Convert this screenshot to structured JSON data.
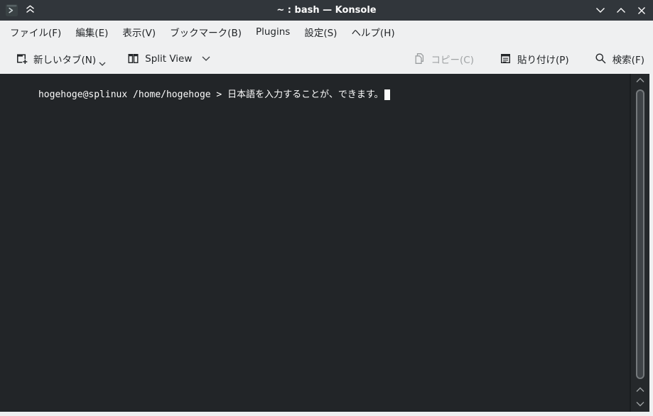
{
  "window": {
    "title": "~ : bash — Konsole"
  },
  "menubar": {
    "items": [
      {
        "label": "ファイル(F)"
      },
      {
        "label": "編集(E)"
      },
      {
        "label": "表示(V)"
      },
      {
        "label": "ブックマーク(B)"
      },
      {
        "label": "Plugins"
      },
      {
        "label": "設定(S)"
      },
      {
        "label": "ヘルプ(H)"
      }
    ]
  },
  "toolbar": {
    "new_tab_label": "新しいタブ(N)",
    "split_view_label": "Split View",
    "copy_label": "コピー(C)",
    "copy_enabled": false,
    "paste_label": "貼り付け(P)",
    "search_label": "検索(F)"
  },
  "terminal": {
    "prompt": "hogehoge@splinux /home/hogehoge > ",
    "typed_text": "日本語を入力することが、できます。",
    "cursor": "block"
  },
  "icons": {
    "konsole": "terminal-prompt-square",
    "keep_above": "double-chevron-up",
    "minimize": "chevron-down",
    "maximize": "chevron-up",
    "close": "x-cross",
    "new_tab": "tab-with-plus",
    "split_view": "two-vertical-panes",
    "copy": "two-pages",
    "paste": "clipboard-with-lines",
    "search": "magnifier",
    "dropdown": "chevron-down",
    "scroll_up": "chevron-up",
    "scroll_down": "chevron-down"
  },
  "colors": {
    "titlebar_bg": "#31363b",
    "titlebar_fg": "#fcfcfc",
    "chrome_bg": "#eff0f1",
    "chrome_fg": "#232629",
    "disabled_fg": "#a0a3a5",
    "terminal_bg": "#222528",
    "terminal_fg": "#fcfcfc",
    "scroll_track": "#25282b",
    "scroll_sep": "#1a1d1f",
    "thumb_border": "#75797c",
    "thumb_fill": "#3f4347",
    "scroll_arrow": "#9da0a3"
  }
}
